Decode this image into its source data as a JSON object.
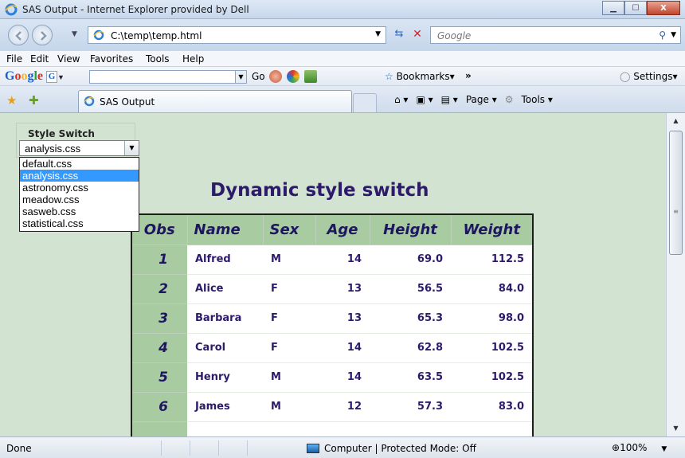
{
  "window": {
    "title": "SAS Output - Internet Explorer provided by Dell",
    "min_glyph": "▁",
    "max_glyph": "☐",
    "close_glyph": "X"
  },
  "address": {
    "url": "C:\\temp\\temp.html",
    "search_placeholder": "Google"
  },
  "menu": [
    "File",
    "Edit",
    "View",
    "Favorites",
    "Tools",
    "Help"
  ],
  "google_toolbar": {
    "logo": "Google",
    "search_value": "",
    "go_label": "Go",
    "bookmarks_label": "Bookmarks▾",
    "more_label": "»",
    "settings_label": "Settings▾"
  },
  "tabs": {
    "active_label": "SAS Output",
    "home_label": "⌂ ▾",
    "feeds_label": "▣ ▾",
    "print_label": "▤ ▾",
    "page_label": "Page ▾",
    "tools_label": "Tools ▾"
  },
  "style_switch": {
    "legend": "Style Switch",
    "selected": "analysis.css",
    "options": [
      "default.css",
      "analysis.css",
      "astronomy.css",
      "meadow.css",
      "sasweb.css",
      "statistical.css"
    ],
    "highlighted_index": 1
  },
  "heading": "Dynamic style switch",
  "table": {
    "columns": [
      "Obs",
      "Name",
      "Sex",
      "Age",
      "Height",
      "Weight"
    ],
    "rows": [
      {
        "obs": "1",
        "name": "Alfred",
        "sex": "M",
        "age": "14",
        "height": "69.0",
        "weight": "112.5"
      },
      {
        "obs": "2",
        "name": "Alice",
        "sex": "F",
        "age": "13",
        "height": "56.5",
        "weight": "84.0"
      },
      {
        "obs": "3",
        "name": "Barbara",
        "sex": "F",
        "age": "13",
        "height": "65.3",
        "weight": "98.0"
      },
      {
        "obs": "4",
        "name": "Carol",
        "sex": "F",
        "age": "14",
        "height": "62.8",
        "weight": "102.5"
      },
      {
        "obs": "5",
        "name": "Henry",
        "sex": "M",
        "age": "14",
        "height": "63.5",
        "weight": "102.5"
      },
      {
        "obs": "6",
        "name": "James",
        "sex": "M",
        "age": "12",
        "height": "57.3",
        "weight": "83.0"
      }
    ]
  },
  "status": {
    "text": "Done",
    "zone": "Computer | Protected Mode: Off",
    "zoom": "100%"
  },
  "colors": {
    "content_bg": "#d2e3d1",
    "header_bg": "#a9cba2",
    "heading_text": "#2d1a6a",
    "selection": "#3399ff"
  }
}
